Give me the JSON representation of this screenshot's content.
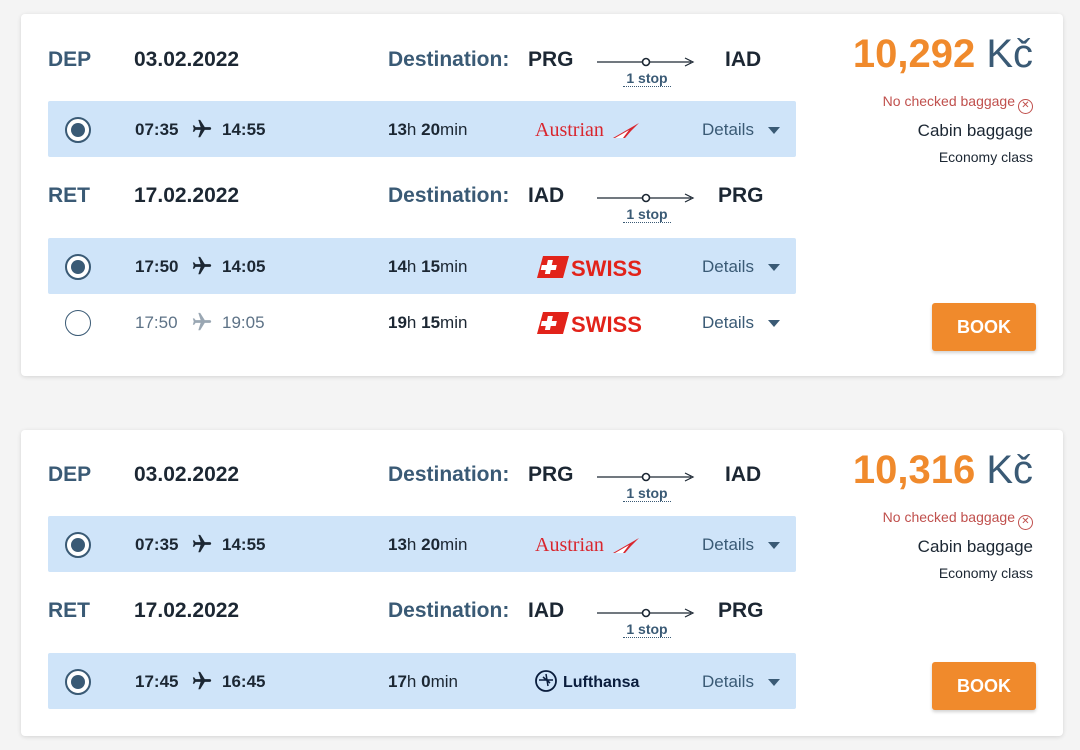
{
  "offers": [
    {
      "price": {
        "amount": "10,292",
        "currency": "Kč"
      },
      "baggage": {
        "checked": "No checked baggage",
        "cabin": "Cabin baggage",
        "class": "Economy class"
      },
      "book_label": "BOOK",
      "dep": {
        "label": "DEP",
        "date": "03.02.2022",
        "destination_label": "Destination:",
        "from": "PRG",
        "to": "IAD",
        "stops": "1 stop"
      },
      "dep_options": [
        {
          "time_dep": "07:35",
          "time_arr": "14:55",
          "dur_h": "13",
          "dur_m": "20",
          "h_unit": "h",
          "m_unit": "min",
          "airline": "Austrian",
          "airline_logo": "austrian-logo",
          "details_label": "Details",
          "selected": true
        }
      ],
      "ret": {
        "label": "RET",
        "date": "17.02.2022",
        "destination_label": "Destination:",
        "from": "IAD",
        "to": "PRG",
        "stops": "1 stop"
      },
      "ret_options": [
        {
          "time_dep": "17:50",
          "time_arr": "14:05",
          "dur_h": "14",
          "dur_m": "15",
          "h_unit": "h",
          "m_unit": "min",
          "airline": "SWISS",
          "airline_logo": "swiss-logo",
          "details_label": "Details",
          "selected": true
        },
        {
          "time_dep": "17:50",
          "time_arr": "19:05",
          "dur_h": "19",
          "dur_m": "15",
          "h_unit": "h",
          "m_unit": "min",
          "airline": "SWISS",
          "airline_logo": "swiss-logo",
          "details_label": "Details",
          "selected": false
        }
      ]
    },
    {
      "price": {
        "amount": "10,316",
        "currency": "Kč"
      },
      "baggage": {
        "checked": "No checked baggage",
        "cabin": "Cabin baggage",
        "class": "Economy class"
      },
      "book_label": "BOOK",
      "dep": {
        "label": "DEP",
        "date": "03.02.2022",
        "destination_label": "Destination:",
        "from": "PRG",
        "to": "IAD",
        "stops": "1 stop"
      },
      "dep_options": [
        {
          "time_dep": "07:35",
          "time_arr": "14:55",
          "dur_h": "13",
          "dur_m": "20",
          "h_unit": "h",
          "m_unit": "min",
          "airline": "Austrian",
          "airline_logo": "austrian-logo",
          "details_label": "Details",
          "selected": true
        }
      ],
      "ret": {
        "label": "RET",
        "date": "17.02.2022",
        "destination_label": "Destination:",
        "from": "IAD",
        "to": "PRG",
        "stops": "1 stop"
      },
      "ret_options": [
        {
          "time_dep": "17:45",
          "time_arr": "16:45",
          "dur_h": "17",
          "dur_m": "0",
          "h_unit": "h",
          "m_unit": "min",
          "airline": "Lufthansa",
          "airline_logo": "lufthansa-logo",
          "details_label": "Details",
          "selected": true
        }
      ]
    }
  ],
  "colors": {
    "accent": "#f08a2c",
    "navy": "#3a5a75",
    "selected_row": "#cfe4f9",
    "no_baggage": "#c0504d",
    "austrian_red": "#d9262e",
    "swiss_red": "#e2231a"
  }
}
